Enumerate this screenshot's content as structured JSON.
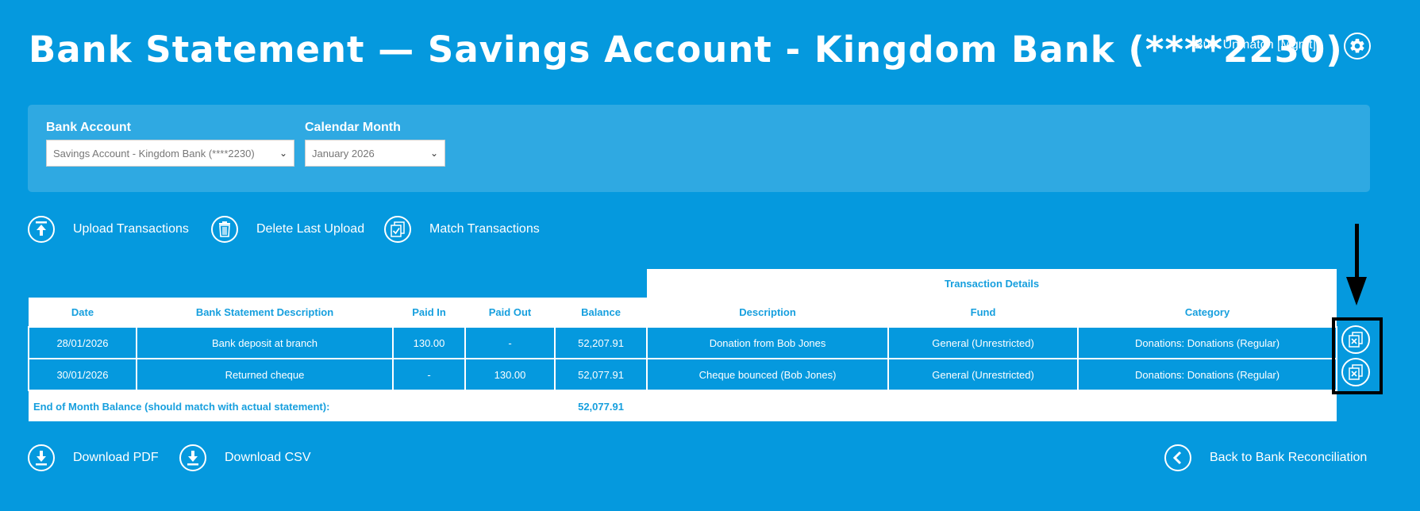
{
  "header": {
    "title": "Bank Statement — Savings Account - Kingdom Bank (****2230)",
    "bulk_unmatch_label": "Bulk Unmatch [Mgmt]"
  },
  "filters": {
    "bank_account_label": "Bank Account",
    "bank_account_value": "Savings Account - Kingdom Bank (****2230)",
    "calendar_month_label": "Calendar Month",
    "calendar_month_value": "January 2026"
  },
  "actions": {
    "upload": "Upload Transactions",
    "delete_last": "Delete Last Upload",
    "match": "Match Transactions"
  },
  "table": {
    "group_header": "Transaction Details",
    "columns": [
      "Date",
      "Bank Statement Description",
      "Paid In",
      "Paid Out",
      "Balance",
      "Description",
      "Fund",
      "Category"
    ],
    "rows": [
      [
        "28/01/2026",
        "Bank deposit at branch",
        "130.00",
        "-",
        "52,207.91",
        "Donation from Bob Jones",
        "General (Unrestricted)",
        "Donations: Donations (Regular)"
      ],
      [
        "30/01/2026",
        "Returned cheque",
        "-",
        "130.00",
        "52,077.91",
        "Cheque bounced (Bob Jones)",
        "General (Unrestricted)",
        "Donations: Donations (Regular)"
      ]
    ],
    "end_label": "End of Month Balance (should match with actual statement):",
    "end_balance": "52,077.91"
  },
  "footer": {
    "download_pdf": "Download PDF",
    "download_csv": "Download CSV",
    "back": "Back to Bank Reconciliation"
  },
  "icons": {
    "gear": "gear-icon",
    "upload": "upload-icon",
    "delete": "trash-icon",
    "match": "clipboard-check-icon",
    "unmatch": "unmatch-icon",
    "download": "download-icon",
    "back": "chevron-left-icon"
  },
  "colors": {
    "background": "#0599de",
    "panel": "#2fa9e2",
    "header_text": "#169fde",
    "highlight_box": "#000000"
  }
}
